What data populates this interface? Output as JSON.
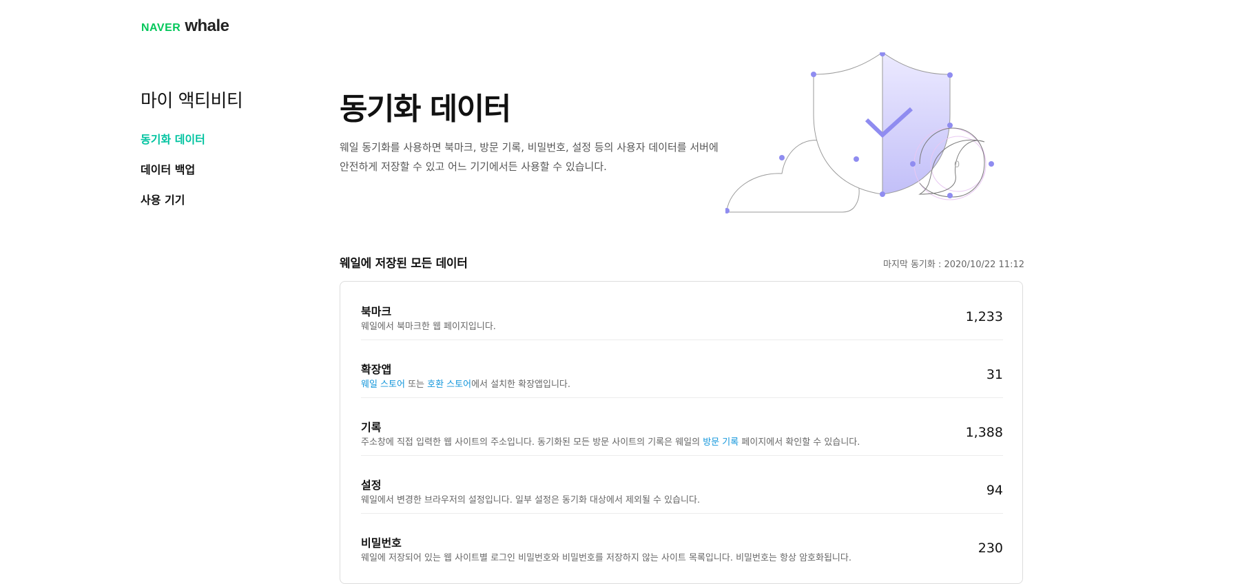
{
  "brand": {
    "naver": "NAVER",
    "whale": "whale"
  },
  "sidebar": {
    "title": "마이 액티비티",
    "items": [
      {
        "label": "동기화 데이터",
        "active": true
      },
      {
        "label": "데이터 백업",
        "active": false
      },
      {
        "label": "사용 기기",
        "active": false
      }
    ]
  },
  "hero": {
    "title": "동기화 데이터",
    "desc_line1": "웨일 동기화를 사용하면 북마크, 방문 기록, 비밀번호, 설정 등의 사용자 데이터를 서버에",
    "desc_line2": "안전하게 저장할 수 있고 어느 기기에서든 사용할 수 있습니다."
  },
  "section": {
    "title": "웨일에 저장된 모든 데이터",
    "last_sync": "마지막 동기화 : 2020/10/22 11:12"
  },
  "rows": [
    {
      "name": "북마크",
      "desc": "웨일에서 북마크한 웹 페이지입니다.",
      "count": "1,233"
    },
    {
      "name": "확장앱",
      "link1": "웨일 스토어",
      "mid1": " 또는 ",
      "link2": "호환 스토어",
      "tail": "에서 설치한 확장앱입니다.",
      "count": "31"
    },
    {
      "name": "기록",
      "pre": "주소창에 직접 입력한 웹 사이트의 주소입니다. 동기화된 모든 방문 사이트의 기록은 웨일의 ",
      "link": "방문 기록",
      "post": " 페이지에서 확인할 수 있습니다.",
      "count": "1,388"
    },
    {
      "name": "설정",
      "desc": "웨일에서 변경한 브라우저의 설정입니다. 일부 설정은 동기화 대상에서 제외될 수 있습니다.",
      "count": "94"
    },
    {
      "name": "비밀번호",
      "desc": "웨일에 저장되어 있는 웹 사이트별 로그인 비밀번호와 비밀번호를 저장하지 않는 사이트 목록입니다. 비밀번호는 항상 암호화됩니다.",
      "count": "230"
    }
  ],
  "illustration": {
    "zero_label": "0"
  },
  "colors": {
    "accent": "#00c3a0",
    "link": "#1296db",
    "brand_green": "#03c75a",
    "shield": "#8f8cf0"
  }
}
